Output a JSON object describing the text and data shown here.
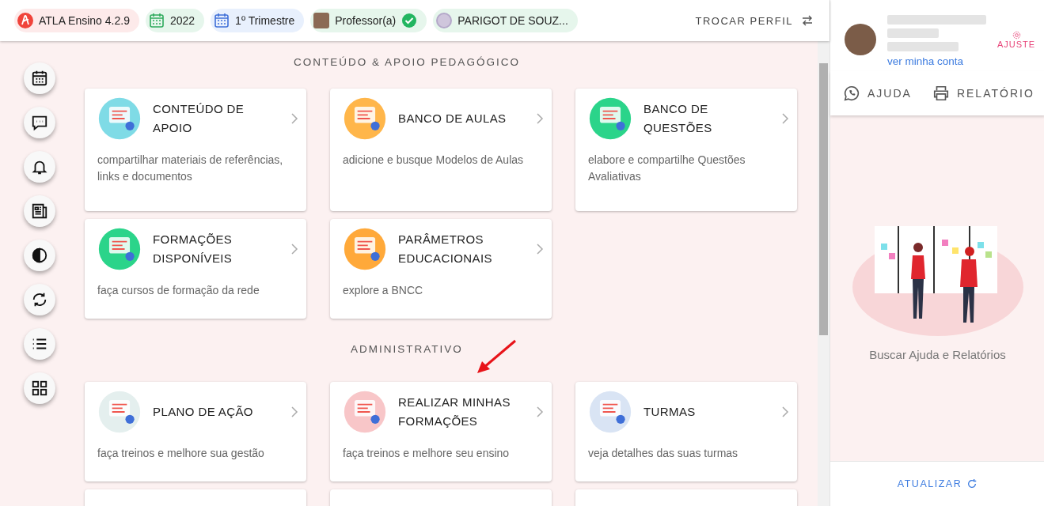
{
  "top_bar": {
    "chips": [
      {
        "kind": "app",
        "label": "ATLA Ensino 4.2.9"
      },
      {
        "kind": "year",
        "label": "2022"
      },
      {
        "kind": "term",
        "label": "1º Trimestre"
      },
      {
        "kind": "role",
        "label": "Professor(a)",
        "verified": true
      },
      {
        "kind": "school",
        "label": "PARIGOT DE SOUZ..."
      }
    ],
    "switch_profile": "TROCAR PERFIL"
  },
  "side_buttons": [
    {
      "kind": "calendar"
    },
    {
      "kind": "chat"
    },
    {
      "kind": "bell"
    },
    {
      "kind": "news"
    },
    {
      "kind": "contrast"
    },
    {
      "kind": "sync"
    },
    {
      "kind": "list"
    },
    {
      "kind": "grid"
    }
  ],
  "sections": [
    {
      "title": "CONTEÚDO & APOIO PEDAGÓGICO",
      "cards": [
        {
          "kind": "plant",
          "title": "CONTEÚDO DE APOIO",
          "description": "compartilhar materiais de referências, links e documentos"
        },
        {
          "kind": "lessons",
          "title": "BANCO DE AULAS",
          "description": "adicione e busque Modelos de Aulas"
        },
        {
          "kind": "questions",
          "title": "BANCO DE QUESTÕES",
          "description": "elabore e compartilhe Questões Avaliativas"
        },
        {
          "kind": "video",
          "title": "FORMAÇÕES DISPONÍVEIS",
          "description": "faça cursos de formação da rede"
        },
        {
          "kind": "checklist",
          "title": "PARÂMETROS EDUCACIONAIS",
          "description": "explore a BNCC"
        }
      ]
    },
    {
      "title": "ADMINISTRATIVO",
      "cards": [
        {
          "kind": "plan",
          "title": "PLANO DE AÇÃO",
          "description": "faça treinos e melhore sua gestão"
        },
        {
          "kind": "certificate",
          "title": "REALIZAR MINHAS FORMAÇÕES",
          "description": "faça treinos e melhore seu ensino",
          "pointed": true
        },
        {
          "kind": "classes",
          "title": "TURMAS",
          "description": "veja detalhes das suas turmas"
        }
      ]
    }
  ],
  "account": {
    "link": "ver minha conta",
    "settings": "AJUSTE"
  },
  "panel_tabs": [
    {
      "label": "AJUDA",
      "kind": "whatsapp"
    },
    {
      "label": "RELATÓRIO",
      "kind": "printer"
    }
  ],
  "panel_caption": "Buscar Ajuda e Relatórios",
  "refresh": "ATUALIZAR"
}
